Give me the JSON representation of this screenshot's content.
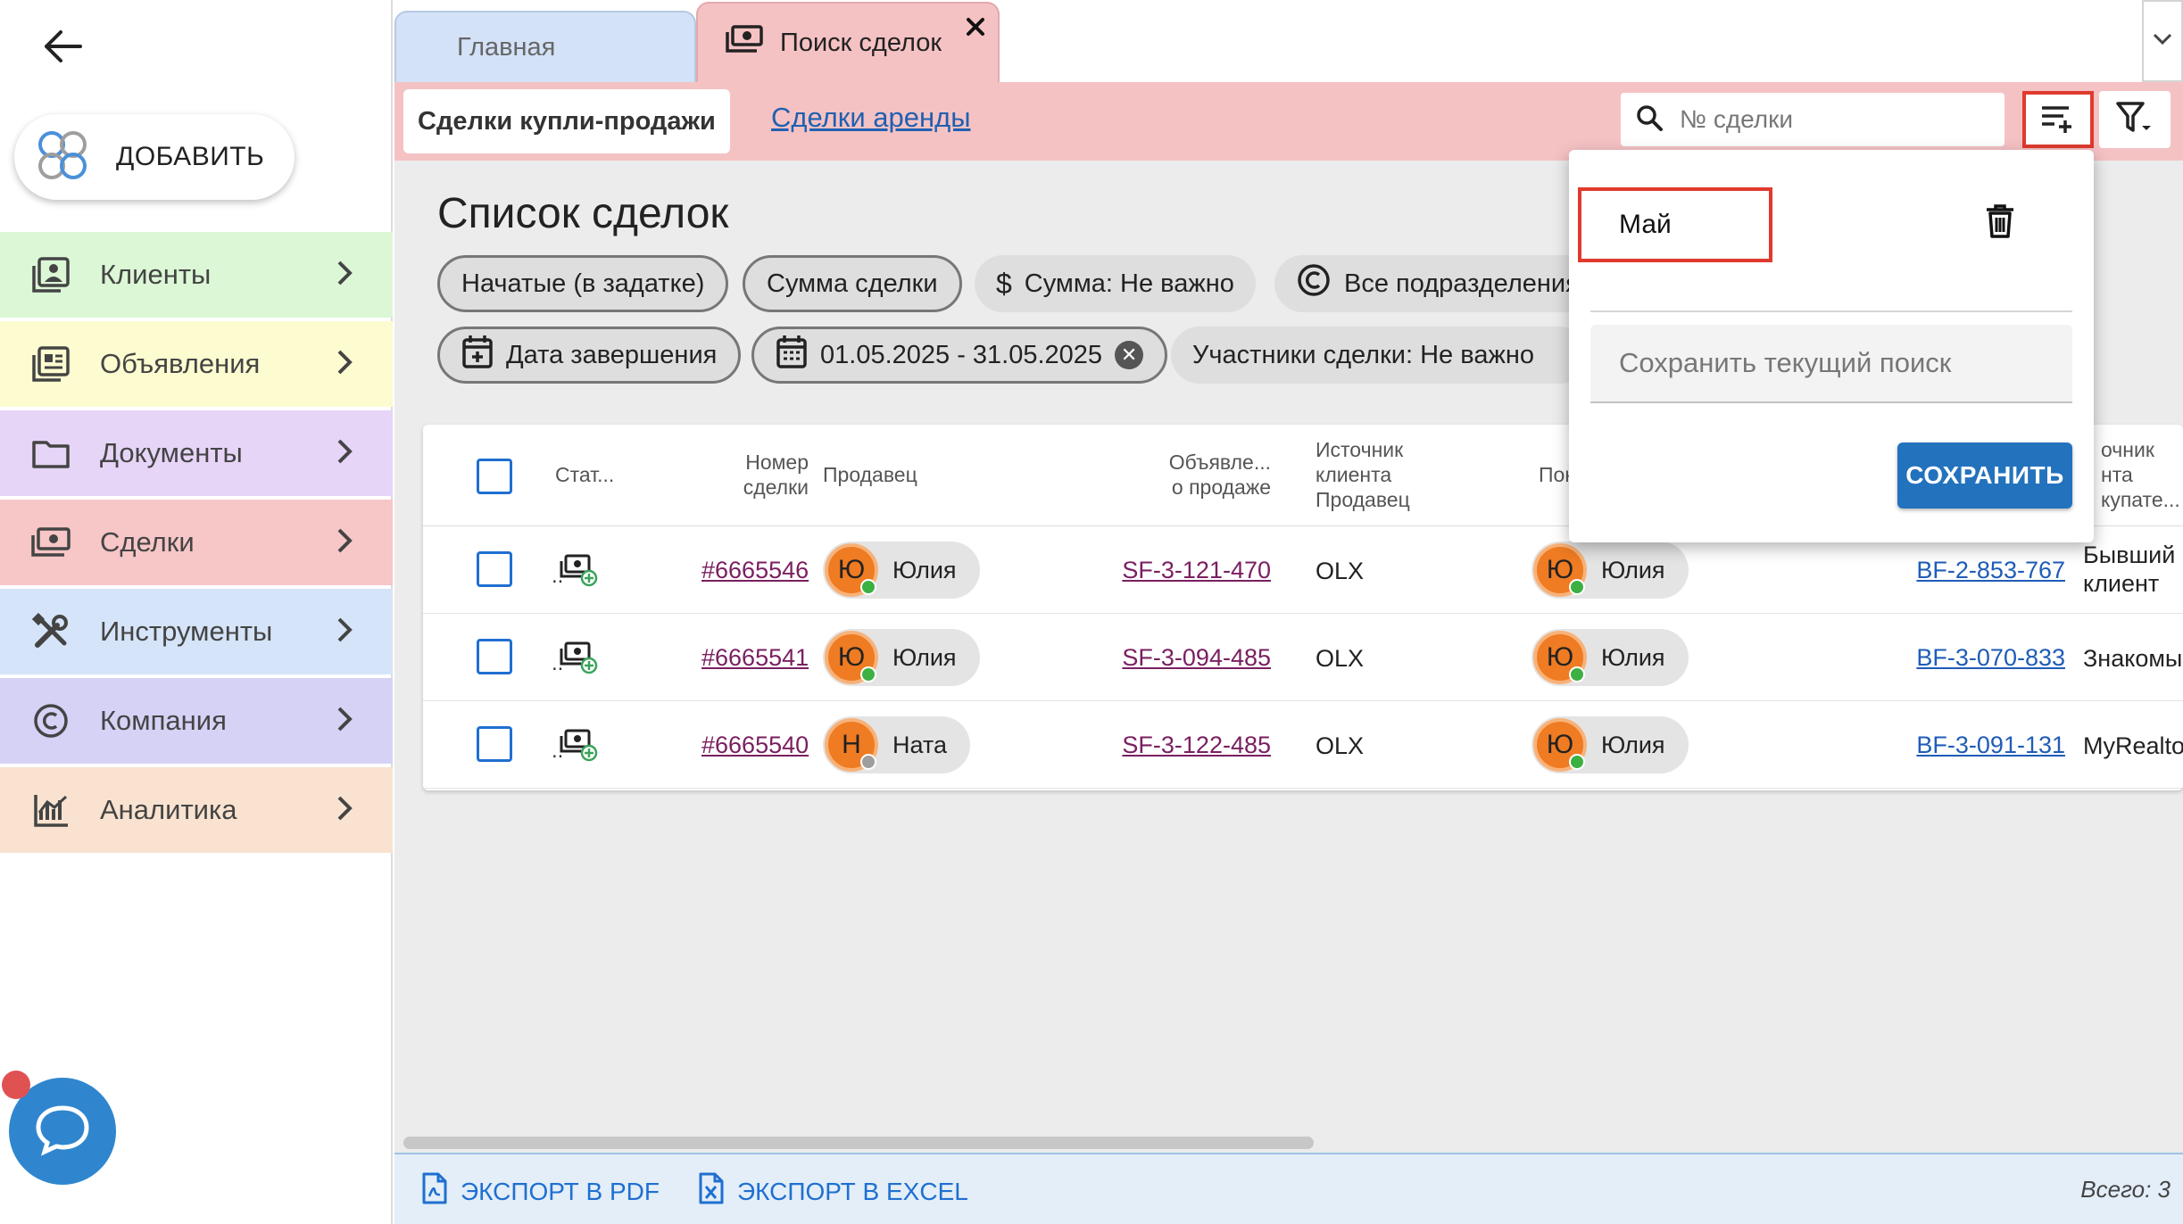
{
  "sidebar": {
    "add_label": "ДОБАВИТЬ",
    "items": [
      {
        "label": "Клиенты",
        "color": "#dcf7d6",
        "icon": "contacts-icon"
      },
      {
        "label": "Объявления",
        "color": "#fdfbd0",
        "icon": "listings-icon"
      },
      {
        "label": "Документы",
        "color": "#e6d5f7",
        "icon": "folder-icon"
      },
      {
        "label": "Сделки",
        "color": "#f7c6c7",
        "icon": "money-icon"
      },
      {
        "label": "Инструменты",
        "color": "#d5e4f8",
        "icon": "tools-icon"
      },
      {
        "label": "Компания",
        "color": "#d6d2f6",
        "icon": "copyright-icon"
      },
      {
        "label": "Аналитика",
        "color": "#f9e3d0",
        "icon": "analytics-icon"
      }
    ]
  },
  "tabs": [
    {
      "label": "Главная"
    },
    {
      "label": "Поиск сделок"
    }
  ],
  "subheader": {
    "active_tab": "Сделки купли-продажи",
    "link_tab": "Сделки аренды",
    "search_placeholder": "№ сделки"
  },
  "main": {
    "title": "Список сделок",
    "chips": [
      "Начатые (в задатке)",
      "Сумма сделки",
      "Сумма: Не важно",
      "Все подразделения",
      "Дата завершения",
      "01.05.2025 - 31.05.2025",
      "Участники сделки: Не важно"
    ]
  },
  "table": {
    "headers": {
      "status": "Стат...",
      "number_l1": "Номер",
      "number_l2": "сделки",
      "seller": "Продавец",
      "ad_l1": "Объявле...",
      "ad_l2": "о продаже",
      "src_l1": "Источник",
      "src_l2": "клиента",
      "src_l3": "Продавец",
      "buyer": "Пок",
      "bsrc_l1": "очник",
      "bsrc_l2": "нта",
      "bsrc_l3": "купате..."
    },
    "rows": [
      {
        "dots": "..",
        "number": "#6665546",
        "seller_initial": "Ю",
        "seller": "Юлия",
        "seller_status": "#3cb043",
        "ad": "SF-3-121-470",
        "source": "OLX",
        "buyer_initial": "Ю",
        "buyer": "Юлия",
        "buyer_status": "#3cb043",
        "buyer_ad": "BF-2-853-767",
        "buyer_source_l1": "Бывший",
        "buyer_source_l2": "клиент"
      },
      {
        "dots": "..",
        "number": "#6665541",
        "seller_initial": "Ю",
        "seller": "Юлия",
        "seller_status": "#3cb043",
        "ad": "SF-3-094-485",
        "source": "OLX",
        "buyer_initial": "Ю",
        "buyer": "Юлия",
        "buyer_status": "#3cb043",
        "buyer_ad": "BF-3-070-833",
        "buyer_source_l1": "Знакомый",
        "buyer_source_l2": ""
      },
      {
        "dots": "..",
        "number": "#6665540",
        "seller_initial": "Н",
        "seller": "Ната",
        "seller_status": "#9e9e9e",
        "ad": "SF-3-122-485",
        "source": "OLX",
        "buyer_initial": "Ю",
        "buyer": "Юлия",
        "buyer_status": "#3cb043",
        "buyer_ad": "BF-3-091-131",
        "buyer_source_l1": "MyRealtor",
        "buyer_source_l2": ""
      }
    ]
  },
  "footer": {
    "export_pdf": "ЭКСПОРТ В PDF",
    "export_excel": "ЭКСПОРТ В EXCEL",
    "total": "Всего: 3"
  },
  "popup": {
    "saved_search": "Май",
    "input_placeholder": "Сохранить текущий поиск",
    "save_label": "СОХРАНИТЬ"
  }
}
